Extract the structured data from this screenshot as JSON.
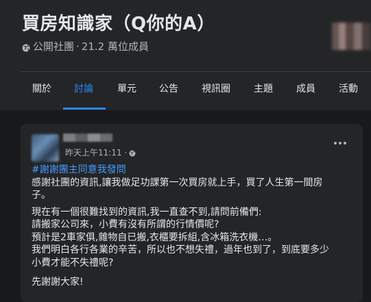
{
  "group": {
    "title": "買房知識家（Q你的A）",
    "privacy": "公開社團",
    "separator": "·",
    "members": "21.2 萬位成員"
  },
  "tabs": [
    "關於",
    "討論",
    "單元",
    "公告",
    "視訊圈",
    "主題",
    "成員",
    "活動"
  ],
  "active_tab": "討論",
  "post": {
    "time": "昨天上午11:11 ·",
    "hashtag": "#謝謝團主同意我發問",
    "lines": [
      "感謝社團的資訊,讓我做足功課第一次買房就上手，買了人生第一間房",
      "子。",
      "現在有一個很難找到的資訊,我一直查不到,請問前備們:",
      "請搬家公司來，小費有沒有所謂的行情價呢?",
      "預計是2車家俱,雜物自已搬,衣櫃要拆組,含冰箱洗衣機…。",
      "我們明白各行各業的辛苦，所以也不想失禮，過年也到了，到底要多少",
      "小費才能不失禮呢?",
      "先謝謝大家!"
    ]
  },
  "colors": {
    "accent": "#2d88ff",
    "hashtag": "#4599ff",
    "background": "#18191a",
    "surface": "#242526"
  }
}
